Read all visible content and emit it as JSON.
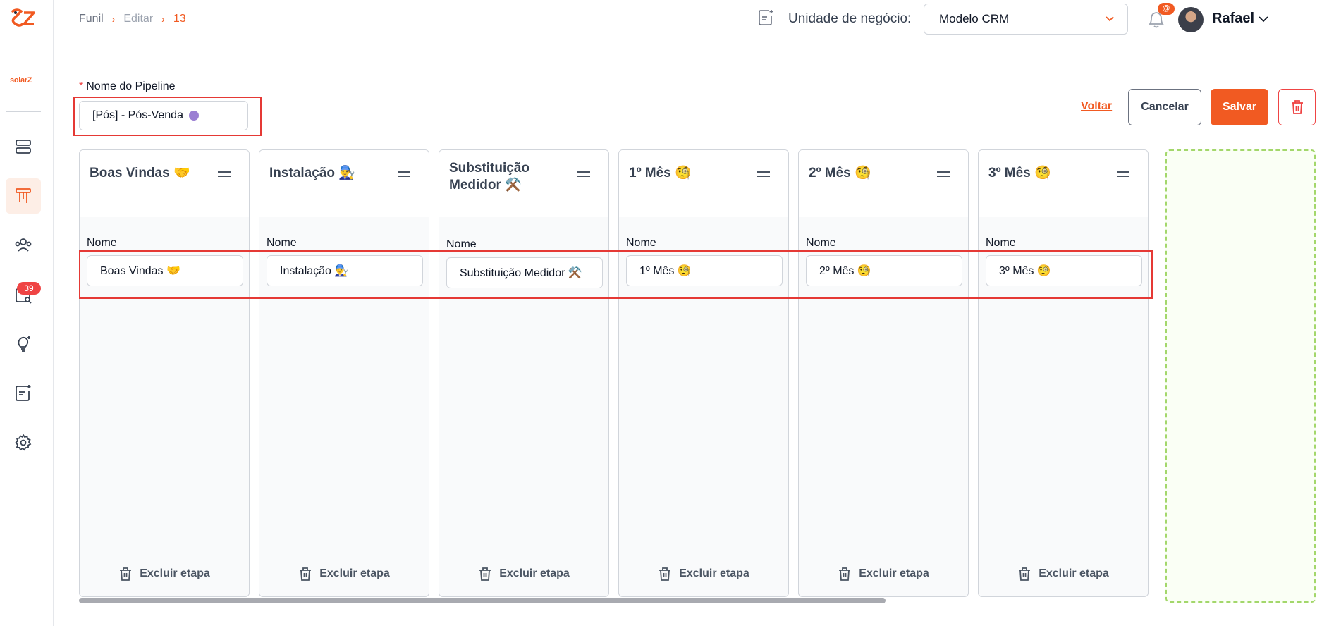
{
  "breadcrumb": {
    "items": [
      "Funil",
      "Editar",
      "13"
    ]
  },
  "header": {
    "business_unit_label": "Unidade de negócio:",
    "business_unit_value": "Modelo CRM",
    "notification_badge": "@",
    "user_name": "Rafael"
  },
  "sidebar": {
    "brand": "solarZ",
    "badge_count": "39",
    "items": [
      "servers-icon",
      "funnel-icon",
      "users-icon",
      "calendar-search-icon",
      "lightbulb-icon",
      "notes-icon",
      "gear-icon"
    ],
    "active_index": 1
  },
  "pipeline": {
    "label": "Nome do Pipeline",
    "required_mark": "*",
    "name": "[Pós] - Pós-Venda",
    "color": "#9b7fd3"
  },
  "actions": {
    "back": "Voltar",
    "cancel": "Cancelar",
    "save": "Salvar"
  },
  "stages": [
    {
      "title": "Boas Vindas 🤝",
      "field_label": "Nome",
      "value": "Boas Vindas 🤝",
      "delete_label": "Excluir etapa"
    },
    {
      "title": "Instalação 👨‍🔧",
      "field_label": "Nome",
      "value": "Instalação 👨‍🔧",
      "delete_label": "Excluir etapa"
    },
    {
      "title": "Substituição Medidor ⚒️",
      "field_label": "Nome",
      "value": "Substituição Medidor ⚒️",
      "delete_label": "Excluir etapa"
    },
    {
      "title": "1º Mês 🧐",
      "field_label": "Nome",
      "value": "1º Mês 🧐",
      "delete_label": "Excluir etapa"
    },
    {
      "title": "2º Mês 🧐",
      "field_label": "Nome",
      "value": "2º Mês 🧐",
      "delete_label": "Excluir etapa"
    },
    {
      "title": "3º Mês 🧐",
      "field_label": "Nome",
      "value": "3º Mês 🧐",
      "delete_label": "Excluir etapa"
    }
  ],
  "colors": {
    "accent": "#f15a22",
    "danger": "#e53935",
    "add_border": "#a3d76b"
  }
}
